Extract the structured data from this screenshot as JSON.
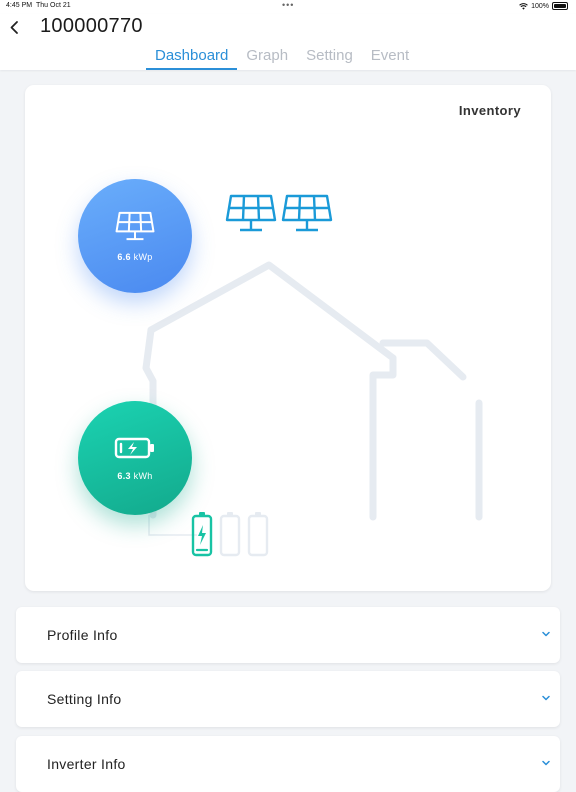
{
  "status_bar": {
    "time": "4:45 PM",
    "date": "Thu Oct 21",
    "battery": "100%"
  },
  "header": {
    "title": "100000770",
    "tabs": [
      {
        "label": "Dashboard",
        "active": true
      },
      {
        "label": "Graph",
        "active": false
      },
      {
        "label": "Setting",
        "active": false
      },
      {
        "label": "Event",
        "active": false
      }
    ]
  },
  "dashboard": {
    "inventory_label": "Inventory",
    "solar": {
      "value": "6.6",
      "unit": "kWp"
    },
    "battery": {
      "value": "6.3",
      "unit": "kWh",
      "modules_shown": 3,
      "modules_active": 1
    }
  },
  "sections": [
    {
      "label": "Profile Info"
    },
    {
      "label": "Setting Info"
    },
    {
      "label": "Inverter Info"
    }
  ],
  "colors": {
    "accent": "#2b8fd8",
    "solar_circle": "#5b9bf6",
    "battery_circle": "#16bd9d",
    "panel_icon": "#1a9ad8",
    "house_outline": "#e6ebf1"
  }
}
